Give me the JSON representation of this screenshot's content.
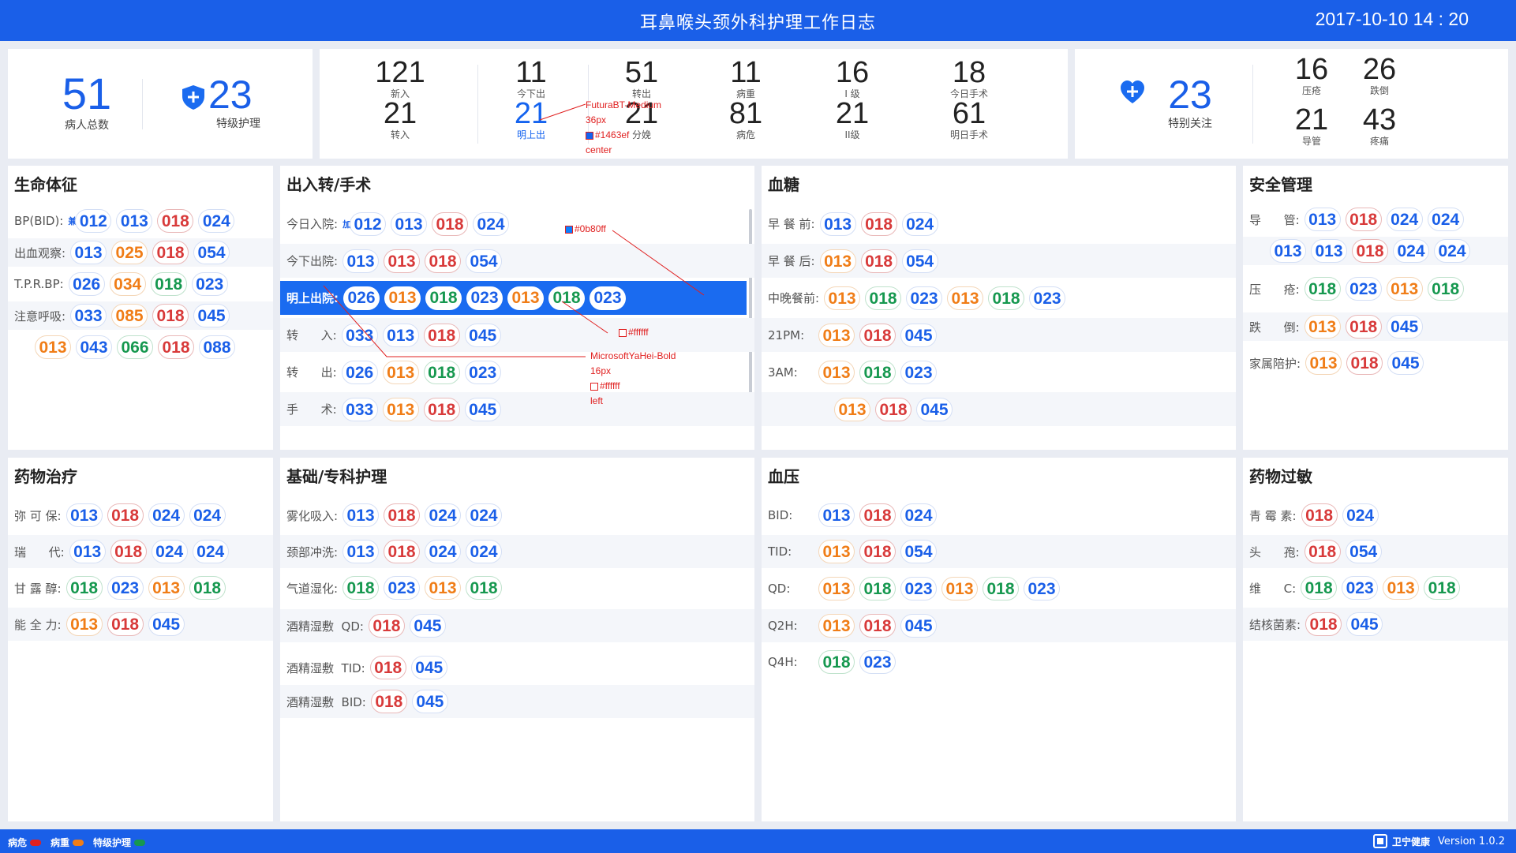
{
  "header": {
    "title": "耳鼻喉头颈外科护理工作日志",
    "datetime": "2017-10-10  14 : 20"
  },
  "summary": {
    "patients_total": {
      "value": "51",
      "label": "病人总数"
    },
    "special_care": {
      "value": "23",
      "label": "特级护理"
    },
    "special_attention": {
      "value": "23",
      "label": "特别关注"
    },
    "flow": [
      {
        "value": "121",
        "label": "新入"
      },
      {
        "value": "11",
        "label": "今下出"
      },
      {
        "value": "51",
        "label": "转出"
      },
      {
        "value": "11",
        "label": "病重"
      },
      {
        "value": "16",
        "label": "I 级"
      },
      {
        "value": "18",
        "label": "今日手术"
      },
      {
        "value": "21",
        "label": "转入"
      },
      {
        "value": "21",
        "label": "明上出"
      },
      {
        "value": "21",
        "label": "分娩"
      },
      {
        "value": "81",
        "label": "病危"
      },
      {
        "value": "21",
        "label": "II级"
      },
      {
        "value": "61",
        "label": "明日手术"
      }
    ],
    "risk": [
      {
        "value": "16",
        "label": "压疮"
      },
      {
        "value": "26",
        "label": "跌倒"
      },
      {
        "value": "21",
        "label": "导管"
      },
      {
        "value": "43",
        "label": "疼痛"
      }
    ]
  },
  "panels": {
    "vitals": {
      "title": "生命体征",
      "rows": [
        {
          "label": "BP(BID):",
          "tag": "兼",
          "pills": [
            [
              "012",
              "b"
            ],
            [
              "013",
              "b"
            ],
            [
              "018",
              "r"
            ],
            [
              "024",
              "b"
            ]
          ]
        },
        {
          "label": "出血观察:",
          "pills": [
            [
              "013",
              "b"
            ],
            [
              "025",
              "o"
            ],
            [
              "018",
              "r"
            ],
            [
              "054",
              "b"
            ]
          ]
        },
        {
          "label": "T.P.R.BP:",
          "pills": [
            [
              "026",
              "b"
            ],
            [
              "034",
              "o"
            ],
            [
              "018",
              "g"
            ],
            [
              "023",
              "b"
            ]
          ]
        },
        {
          "label": "注意呼吸:",
          "pills": [
            [
              "033",
              "b"
            ],
            [
              "085",
              "o"
            ],
            [
              "018",
              "r"
            ],
            [
              "045",
              "b"
            ]
          ]
        },
        {
          "label": "",
          "pills": [
            [
              "013",
              "o"
            ],
            [
              "043",
              "b"
            ],
            [
              "066",
              "g"
            ],
            [
              "018",
              "r"
            ],
            [
              "088",
              "b"
            ]
          ]
        }
      ]
    },
    "transfer": {
      "title": "出入转/手术",
      "rows": [
        {
          "label": "今日入院:",
          "tag": "加",
          "pills": [
            [
              "012",
              "b"
            ],
            [
              "013",
              "b"
            ],
            [
              "018",
              "r"
            ],
            [
              "024",
              "b"
            ]
          ]
        },
        {
          "label": "今下出院:",
          "pills": [
            [
              "013",
              "b"
            ],
            [
              "013",
              "r"
            ],
            [
              "018",
              "r"
            ],
            [
              "054",
              "b"
            ]
          ]
        },
        {
          "label": "明上出院:",
          "pills": [
            [
              "026",
              "b"
            ],
            [
              "013",
              "o"
            ],
            [
              "018",
              "g"
            ],
            [
              "023",
              "b"
            ],
            [
              "013",
              "o"
            ],
            [
              "018",
              "g"
            ],
            [
              "023",
              "b"
            ]
          ]
        },
        {
          "label": "转      入:",
          "pills": [
            [
              "033",
              "b"
            ],
            [
              "013",
              "b"
            ],
            [
              "018",
              "r"
            ],
            [
              "045",
              "b"
            ]
          ]
        },
        {
          "label": "转      出:",
          "pills": [
            [
              "026",
              "b"
            ],
            [
              "013",
              "o"
            ],
            [
              "018",
              "g"
            ],
            [
              "023",
              "b"
            ]
          ]
        },
        {
          "label": "手      术:",
          "pills": [
            [
              "033",
              "b"
            ],
            [
              "013",
              "o"
            ],
            [
              "018",
              "r"
            ],
            [
              "045",
              "b"
            ]
          ]
        }
      ]
    },
    "glucose": {
      "title": "血糖",
      "rows": [
        {
          "label": "早 餐 前:",
          "pills": [
            [
              "013",
              "b"
            ],
            [
              "018",
              "r"
            ],
            [
              "024",
              "b"
            ]
          ]
        },
        {
          "label": "早 餐 后:",
          "pills": [
            [
              "013",
              "o"
            ],
            [
              "018",
              "r"
            ],
            [
              "054",
              "b"
            ]
          ]
        },
        {
          "label": "中晚餐前:",
          "pills": [
            [
              "013",
              "o"
            ],
            [
              "018",
              "g"
            ],
            [
              "023",
              "b"
            ],
            [
              "013",
              "o"
            ],
            [
              "018",
              "g"
            ],
            [
              "023",
              "b"
            ]
          ]
        },
        {
          "label": "21PM:",
          "pills": [
            [
              "013",
              "o"
            ],
            [
              "018",
              "r"
            ],
            [
              "045",
              "b"
            ]
          ]
        },
        {
          "label": "3AM:",
          "pills": [
            [
              "013",
              "o"
            ],
            [
              "018",
              "g"
            ],
            [
              "023",
              "b"
            ]
          ]
        },
        {
          "label": "",
          "pills": [
            [
              "013",
              "o"
            ],
            [
              "018",
              "r"
            ],
            [
              "045",
              "b"
            ]
          ]
        }
      ]
    },
    "safety": {
      "title": "安全管理",
      "rows": [
        {
          "label": "导      管:",
          "pills": [
            [
              "013",
              "b"
            ],
            [
              "018",
              "r"
            ],
            [
              "024",
              "b"
            ],
            [
              "024",
              "b"
            ]
          ]
        },
        {
          "label": "",
          "pills": [
            [
              "013",
              "b"
            ],
            [
              "013",
              "b"
            ],
            [
              "018",
              "r"
            ],
            [
              "024",
              "b"
            ],
            [
              "024",
              "b"
            ]
          ]
        },
        {
          "label": "压      疮:",
          "pills": [
            [
              "018",
              "g"
            ],
            [
              "023",
              "b"
            ],
            [
              "013",
              "o"
            ],
            [
              "018",
              "g"
            ]
          ]
        },
        {
          "label": "跌      倒:",
          "pills": [
            [
              "013",
              "o"
            ],
            [
              "018",
              "r"
            ],
            [
              "045",
              "b"
            ]
          ]
        },
        {
          "label": "家属陪护:",
          "pills": [
            [
              "013",
              "o"
            ],
            [
              "018",
              "r"
            ],
            [
              "045",
              "b"
            ]
          ]
        }
      ]
    },
    "medication": {
      "title": "药物治疗",
      "rows": [
        {
          "label": "弥 可 保:",
          "pills": [
            [
              "013",
              "b"
            ],
            [
              "018",
              "r"
            ],
            [
              "024",
              "b"
            ],
            [
              "024",
              "b"
            ]
          ]
        },
        {
          "label": "瑞      代:",
          "pills": [
            [
              "013",
              "b"
            ],
            [
              "018",
              "r"
            ],
            [
              "024",
              "b"
            ],
            [
              "024",
              "b"
            ]
          ]
        },
        {
          "label": "甘 露 醇:",
          "pills": [
            [
              "018",
              "g"
            ],
            [
              "023",
              "b"
            ],
            [
              "013",
              "o"
            ],
            [
              "018",
              "g"
            ]
          ]
        },
        {
          "label": "能 全 力:",
          "pills": [
            [
              "013",
              "o"
            ],
            [
              "018",
              "r"
            ],
            [
              "045",
              "b"
            ]
          ]
        }
      ]
    },
    "nursing": {
      "title": "基础/专科护理",
      "rows": [
        {
          "label": "雾化吸入:",
          "pills": [
            [
              "013",
              "b"
            ],
            [
              "018",
              "r"
            ],
            [
              "024",
              "b"
            ],
            [
              "024",
              "b"
            ]
          ]
        },
        {
          "label": "颈部冲洗:",
          "pills": [
            [
              "013",
              "b"
            ],
            [
              "018",
              "r"
            ],
            [
              "024",
              "b"
            ],
            [
              "024",
              "b"
            ]
          ]
        },
        {
          "label": "气道湿化:",
          "pills": [
            [
              "018",
              "g"
            ],
            [
              "023",
              "b"
            ],
            [
              "013",
              "o"
            ],
            [
              "018",
              "g"
            ]
          ]
        },
        {
          "label": "酒精湿敷  QD:",
          "pills": [
            [
              "018",
              "r"
            ],
            [
              "045",
              "b"
            ]
          ]
        },
        {
          "label": "酒精湿敷  TID:",
          "pills": [
            [
              "018",
              "r"
            ],
            [
              "045",
              "b"
            ]
          ]
        },
        {
          "label": "酒精湿敷  BID:",
          "pills": [
            [
              "018",
              "r"
            ],
            [
              "045",
              "b"
            ]
          ]
        }
      ]
    },
    "bp": {
      "title": "血压",
      "rows": [
        {
          "label": "BID:",
          "pills": [
            [
              "013",
              "b"
            ],
            [
              "018",
              "r"
            ],
            [
              "024",
              "b"
            ]
          ]
        },
        {
          "label": "TID:",
          "pills": [
            [
              "013",
              "o"
            ],
            [
              "018",
              "r"
            ],
            [
              "054",
              "b"
            ]
          ]
        },
        {
          "label": "QD:",
          "pills": [
            [
              "013",
              "o"
            ],
            [
              "018",
              "g"
            ],
            [
              "023",
              "b"
            ],
            [
              "013",
              "o"
            ],
            [
              "018",
              "g"
            ],
            [
              "023",
              "b"
            ]
          ]
        },
        {
          "label": "Q2H:",
          "pills": [
            [
              "013",
              "o"
            ],
            [
              "018",
              "r"
            ],
            [
              "045",
              "b"
            ]
          ]
        },
        {
          "label": "Q4H:",
          "pills": [
            [
              "018",
              "g"
            ],
            [
              "023",
              "b"
            ]
          ]
        }
      ]
    },
    "allergy": {
      "title": "药物过敏",
      "rows": [
        {
          "label": "青 霉 素:",
          "pills": [
            [
              "018",
              "r"
            ],
            [
              "024",
              "b"
            ]
          ]
        },
        {
          "label": "头      孢:",
          "pills": [
            [
              "018",
              "r"
            ],
            [
              "054",
              "b"
            ]
          ]
        },
        {
          "label": "维      C:",
          "pills": [
            [
              "018",
              "g"
            ],
            [
              "023",
              "b"
            ],
            [
              "013",
              "o"
            ],
            [
              "018",
              "g"
            ]
          ]
        },
        {
          "label": "结核菌素:",
          "pills": [
            [
              "018",
              "r"
            ],
            [
              "045",
              "b"
            ]
          ]
        }
      ]
    }
  },
  "annotations": {
    "font_note": [
      "FuturaBT-Medium",
      "36px",
      "#1463ef",
      "center"
    ],
    "row_bg_note": "#0b80ff",
    "pill_bg_note": "#ffffff",
    "label_note": [
      "MicrosoftYaHei-Bold",
      "16px",
      "#ffffff",
      "left"
    ]
  },
  "footer": {
    "legend": [
      {
        "label": "病危",
        "color": "#e02020"
      },
      {
        "label": "病重",
        "color": "#f07d17"
      },
      {
        "label": "特级护理",
        "color": "#16984f"
      }
    ],
    "brand": "卫宁健康",
    "version": "Version 1.0.2"
  }
}
